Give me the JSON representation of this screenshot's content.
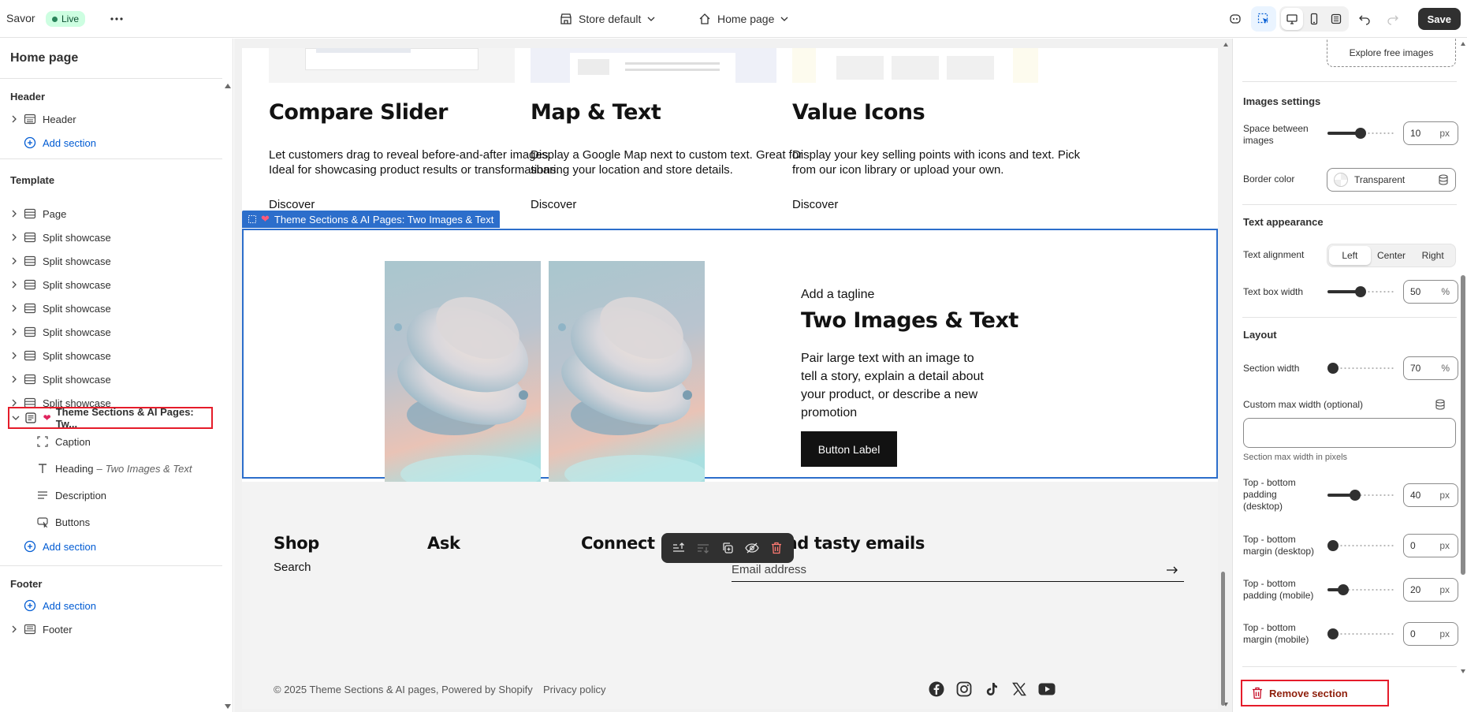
{
  "topbar": {
    "app_name": "Savor",
    "status": "Live",
    "theme_selector": "Store default",
    "page_selector": "Home page",
    "save_label": "Save"
  },
  "sidebar": {
    "title": "Home page",
    "header_group": "Header",
    "header_items": [
      {
        "label": "Header"
      }
    ],
    "add_section": "Add section",
    "template_group": "Template",
    "template_items": [
      {
        "label": "Page"
      },
      {
        "label": "Split showcase"
      },
      {
        "label": "Split showcase"
      },
      {
        "label": "Split showcase"
      },
      {
        "label": "Split showcase"
      },
      {
        "label": "Split showcase"
      },
      {
        "label": "Split showcase"
      },
      {
        "label": "Split showcase"
      },
      {
        "label": "Split showcase"
      }
    ],
    "selected_section": "Theme Sections & AI Pages: Tw...",
    "blocks": [
      {
        "label": "Caption"
      },
      {
        "label": "Heading",
        "sub": "Two Images & Text"
      },
      {
        "label": "Description"
      },
      {
        "label": "Buttons"
      }
    ],
    "footer_group": "Footer",
    "footer_items": [
      {
        "label": "Footer"
      }
    ]
  },
  "preview": {
    "cards": [
      {
        "title": "Compare Slider",
        "text": "Let customers drag to reveal before-and-after images. Ideal for showcasing product results or transformations.",
        "link": "Discover"
      },
      {
        "title": "Map & Text",
        "text": "Display a Google Map next to custom text. Great for sharing your location and store details.",
        "link": "Discover"
      },
      {
        "title": "Value Icons",
        "text": "Display your key selling points with icons and text. Pick from our icon library or upload your own.",
        "link": "Discover"
      }
    ],
    "section_tag": "Theme Sections & AI Pages: Two Images & Text",
    "section": {
      "tagline": "Add a tagline",
      "heading": "Two Images & Text",
      "description": "Pair large text with an image to tell a story, explain a detail about your product, or describe a new promotion",
      "button": "Button Label"
    },
    "footer": {
      "columns": [
        {
          "title": "Shop",
          "link": "Search"
        },
        {
          "title": "Ask"
        },
        {
          "title": "Connect"
        }
      ],
      "newsletter_title": "We send tasty emails",
      "email_placeholder": "Email address",
      "copyright": "© 2025 Theme Sections & AI pages, Powered by Shopify",
      "privacy": "Privacy policy",
      "social": [
        "facebook-icon",
        "instagram-icon",
        "tiktok-icon",
        "x-icon",
        "youtube-icon"
      ]
    }
  },
  "settings": {
    "explore_images": "Explore free images",
    "images_settings_title": "Images settings",
    "space_between_label": "Space between images",
    "space_between_value": "10",
    "border_color_label": "Border color",
    "border_color_value": "Transparent",
    "text_appearance_title": "Text appearance",
    "text_alignment_label": "Text alignment",
    "alignment_options": [
      "Left",
      "Center",
      "Right"
    ],
    "alignment_selected": "Left",
    "text_box_width_label": "Text box width",
    "text_box_width_value": "50",
    "layout_title": "Layout",
    "section_width_label": "Section width",
    "section_width_value": "70",
    "custom_max_width_label": "Custom max width (optional)",
    "custom_max_width_help": "Section max width in pixels",
    "pad_desktop_label": "Top - bottom padding (desktop)",
    "pad_desktop_value": "40",
    "margin_desktop_label": "Top - bottom margin (desktop)",
    "margin_desktop_value": "0",
    "pad_mobile_label": "Top - bottom padding (mobile)",
    "pad_mobile_value": "20",
    "margin_mobile_label": "Top - bottom margin (mobile)",
    "margin_mobile_value": "0",
    "unit_px": "px",
    "unit_pct": "%",
    "remove_section": "Remove section"
  },
  "colors": {
    "accent_blue": "#2c6ecb",
    "highlight_red": "#e51c2a",
    "live_green": "#29845a"
  }
}
